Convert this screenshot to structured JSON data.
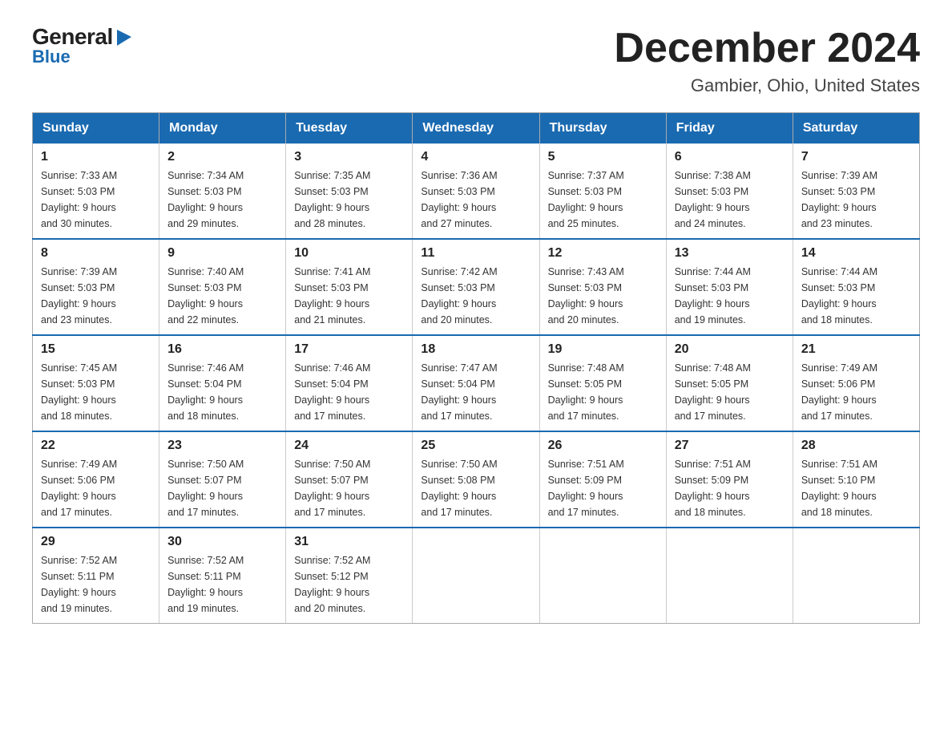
{
  "logo": {
    "general": "General",
    "arrow": "▶",
    "blue": "Blue"
  },
  "title": "December 2024",
  "subtitle": "Gambier, Ohio, United States",
  "days_of_week": [
    "Sunday",
    "Monday",
    "Tuesday",
    "Wednesday",
    "Thursday",
    "Friday",
    "Saturday"
  ],
  "weeks": [
    [
      {
        "day": "1",
        "sunrise": "7:33 AM",
        "sunset": "5:03 PM",
        "daylight": "9 hours and 30 minutes."
      },
      {
        "day": "2",
        "sunrise": "7:34 AM",
        "sunset": "5:03 PM",
        "daylight": "9 hours and 29 minutes."
      },
      {
        "day": "3",
        "sunrise": "7:35 AM",
        "sunset": "5:03 PM",
        "daylight": "9 hours and 28 minutes."
      },
      {
        "day": "4",
        "sunrise": "7:36 AM",
        "sunset": "5:03 PM",
        "daylight": "9 hours and 27 minutes."
      },
      {
        "day": "5",
        "sunrise": "7:37 AM",
        "sunset": "5:03 PM",
        "daylight": "9 hours and 25 minutes."
      },
      {
        "day": "6",
        "sunrise": "7:38 AM",
        "sunset": "5:03 PM",
        "daylight": "9 hours and 24 minutes."
      },
      {
        "day": "7",
        "sunrise": "7:39 AM",
        "sunset": "5:03 PM",
        "daylight": "9 hours and 23 minutes."
      }
    ],
    [
      {
        "day": "8",
        "sunrise": "7:39 AM",
        "sunset": "5:03 PM",
        "daylight": "9 hours and 23 minutes."
      },
      {
        "day": "9",
        "sunrise": "7:40 AM",
        "sunset": "5:03 PM",
        "daylight": "9 hours and 22 minutes."
      },
      {
        "day": "10",
        "sunrise": "7:41 AM",
        "sunset": "5:03 PM",
        "daylight": "9 hours and 21 minutes."
      },
      {
        "day": "11",
        "sunrise": "7:42 AM",
        "sunset": "5:03 PM",
        "daylight": "9 hours and 20 minutes."
      },
      {
        "day": "12",
        "sunrise": "7:43 AM",
        "sunset": "5:03 PM",
        "daylight": "9 hours and 20 minutes."
      },
      {
        "day": "13",
        "sunrise": "7:44 AM",
        "sunset": "5:03 PM",
        "daylight": "9 hours and 19 minutes."
      },
      {
        "day": "14",
        "sunrise": "7:44 AM",
        "sunset": "5:03 PM",
        "daylight": "9 hours and 18 minutes."
      }
    ],
    [
      {
        "day": "15",
        "sunrise": "7:45 AM",
        "sunset": "5:03 PM",
        "daylight": "9 hours and 18 minutes."
      },
      {
        "day": "16",
        "sunrise": "7:46 AM",
        "sunset": "5:04 PM",
        "daylight": "9 hours and 18 minutes."
      },
      {
        "day": "17",
        "sunrise": "7:46 AM",
        "sunset": "5:04 PM",
        "daylight": "9 hours and 17 minutes."
      },
      {
        "day": "18",
        "sunrise": "7:47 AM",
        "sunset": "5:04 PM",
        "daylight": "9 hours and 17 minutes."
      },
      {
        "day": "19",
        "sunrise": "7:48 AM",
        "sunset": "5:05 PM",
        "daylight": "9 hours and 17 minutes."
      },
      {
        "day": "20",
        "sunrise": "7:48 AM",
        "sunset": "5:05 PM",
        "daylight": "9 hours and 17 minutes."
      },
      {
        "day": "21",
        "sunrise": "7:49 AM",
        "sunset": "5:06 PM",
        "daylight": "9 hours and 17 minutes."
      }
    ],
    [
      {
        "day": "22",
        "sunrise": "7:49 AM",
        "sunset": "5:06 PM",
        "daylight": "9 hours and 17 minutes."
      },
      {
        "day": "23",
        "sunrise": "7:50 AM",
        "sunset": "5:07 PM",
        "daylight": "9 hours and 17 minutes."
      },
      {
        "day": "24",
        "sunrise": "7:50 AM",
        "sunset": "5:07 PM",
        "daylight": "9 hours and 17 minutes."
      },
      {
        "day": "25",
        "sunrise": "7:50 AM",
        "sunset": "5:08 PM",
        "daylight": "9 hours and 17 minutes."
      },
      {
        "day": "26",
        "sunrise": "7:51 AM",
        "sunset": "5:09 PM",
        "daylight": "9 hours and 17 minutes."
      },
      {
        "day": "27",
        "sunrise": "7:51 AM",
        "sunset": "5:09 PM",
        "daylight": "9 hours and 18 minutes."
      },
      {
        "day": "28",
        "sunrise": "7:51 AM",
        "sunset": "5:10 PM",
        "daylight": "9 hours and 18 minutes."
      }
    ],
    [
      {
        "day": "29",
        "sunrise": "7:52 AM",
        "sunset": "5:11 PM",
        "daylight": "9 hours and 19 minutes."
      },
      {
        "day": "30",
        "sunrise": "7:52 AM",
        "sunset": "5:11 PM",
        "daylight": "9 hours and 19 minutes."
      },
      {
        "day": "31",
        "sunrise": "7:52 AM",
        "sunset": "5:12 PM",
        "daylight": "9 hours and 20 minutes."
      },
      null,
      null,
      null,
      null
    ]
  ]
}
